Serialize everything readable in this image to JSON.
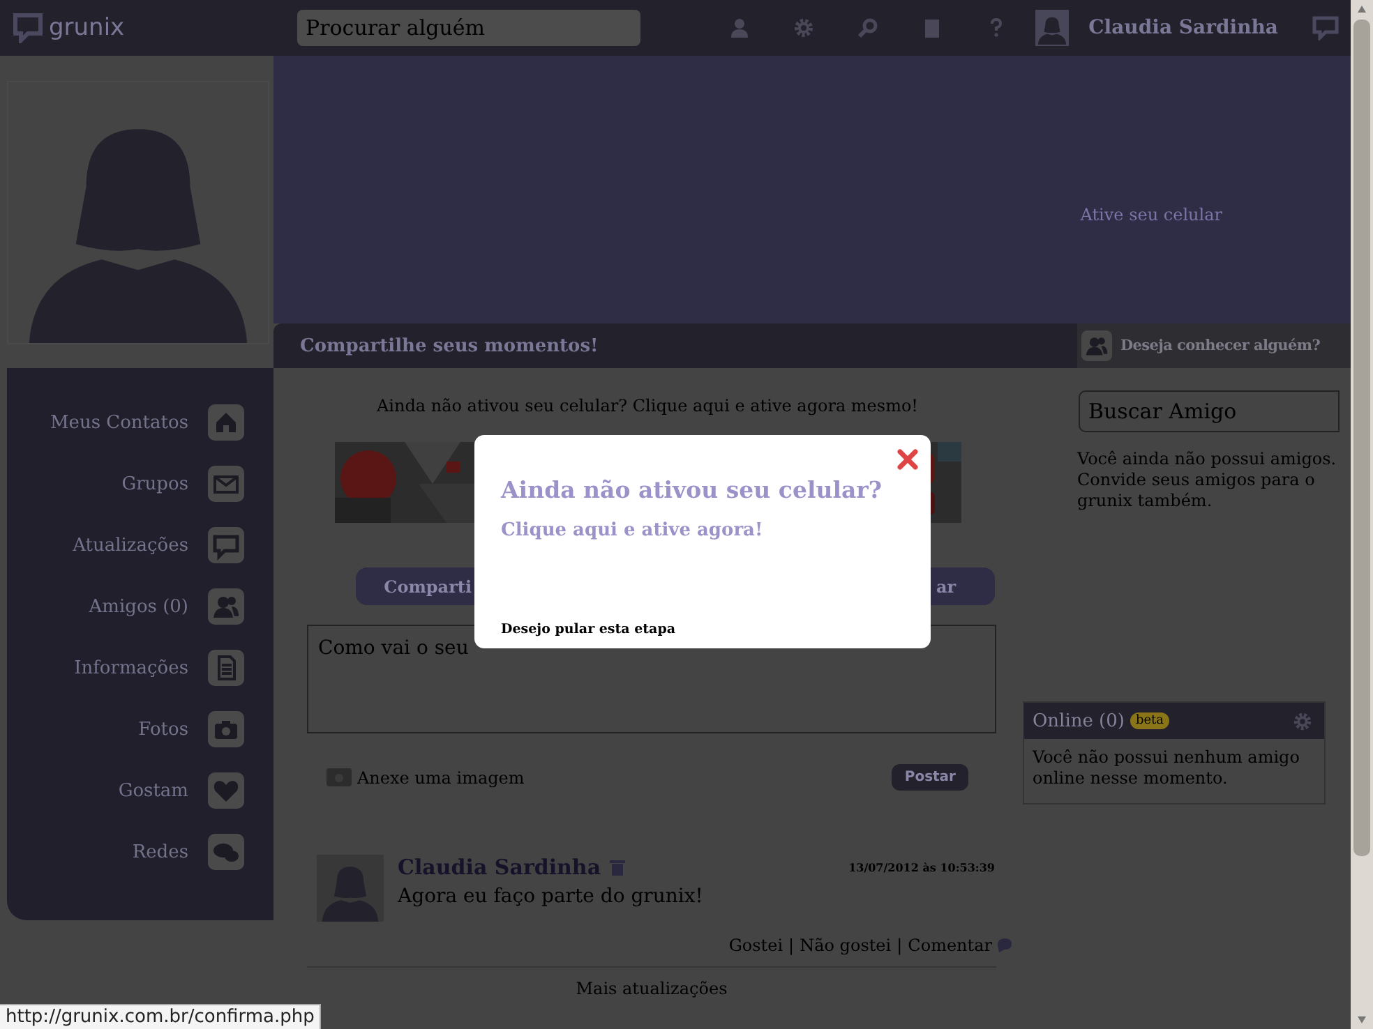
{
  "header": {
    "logo": "grunix",
    "search": {
      "placeholder": "Procurar alguém"
    },
    "user_name": "Claudia Sardinha"
  },
  "cover": {
    "link": "Ative seu celular"
  },
  "share_bar": {
    "title": "Compartilhe seus momentos!"
  },
  "suggest_bar": {
    "title": "Deseja conhecer alguém?"
  },
  "sidebar": {
    "items": [
      {
        "label": "Meus Contatos",
        "kind": "home"
      },
      {
        "label": "Grupos",
        "kind": "mail"
      },
      {
        "label": "Atualizações",
        "kind": "chat"
      },
      {
        "label": "Amigos (0)",
        "kind": "people"
      },
      {
        "label": "Informações",
        "kind": "doc"
      },
      {
        "label": "Fotos",
        "kind": "camera"
      },
      {
        "label": "Gostam",
        "kind": "heart"
      },
      {
        "label": "Redes",
        "kind": "bubbles"
      }
    ]
  },
  "feed": {
    "notice": "Ainda não ativou seu celular? Clique aqui e ative agora mesmo!",
    "buttons": [
      "Comparti",
      "ar"
    ],
    "composer": {
      "placeholder": "Como vai o seu"
    },
    "attach": "Anexe uma imagem",
    "post_button": "Postar",
    "posts": [
      {
        "author": "Claudia Sardinha",
        "time": "13/07/2012 às 10:53:39",
        "text": "Agora eu faço parte do grunix!",
        "actions": [
          "Gostei",
          "Não gostei",
          "Comentar"
        ],
        "separator": "|"
      }
    ],
    "more": "Mais atualizações"
  },
  "friends": {
    "search": {
      "placeholder": "Buscar Amigo"
    },
    "empty": "Você ainda não possui amigos. Convide seus amigos para o grunix também."
  },
  "online": {
    "title": "Online (0)",
    "badge": "beta",
    "empty": "Você não possui nenhum amigo online nesse momento."
  },
  "modal": {
    "title": "Ainda não ativou seu celular?",
    "link": "Clique aqui e ative agora!",
    "skip": "Desejo pular esta etapa"
  },
  "status_url": "http://grunix.com.br/confirma.php"
}
